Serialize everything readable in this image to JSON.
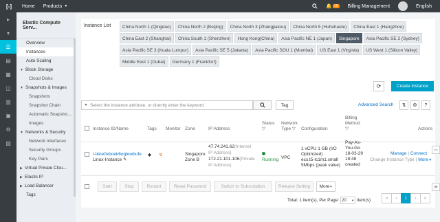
{
  "topbar": {
    "logo_glyph": "[-]",
    "home": "Home",
    "products": "Products",
    "notifications": "19",
    "billing": "Billing Management",
    "language": "English"
  },
  "sidebar": {
    "title": "Elastic Compute Serv...",
    "items": [
      {
        "label": "Overview",
        "kind": "item"
      },
      {
        "label": "Instances",
        "kind": "item",
        "active": true
      },
      {
        "label": "Auto Scaling",
        "kind": "item"
      },
      {
        "label": "Block Storage",
        "kind": "group"
      },
      {
        "label": "Cloud Disks",
        "kind": "sub"
      },
      {
        "label": "Snapshots & Images",
        "kind": "group"
      },
      {
        "label": "Snapshots",
        "kind": "sub"
      },
      {
        "label": "Snapshot Chain",
        "kind": "sub"
      },
      {
        "label": "Automatic Snapsho...",
        "kind": "sub"
      },
      {
        "label": "Images",
        "kind": "sub"
      },
      {
        "label": "Networks & Security",
        "kind": "group"
      },
      {
        "label": "Network Interfaces",
        "kind": "sub"
      },
      {
        "label": "Security Groups",
        "kind": "sub"
      },
      {
        "label": "Key Pairs",
        "kind": "sub"
      },
      {
        "label": "Virtual Private Clou...",
        "kind": "collapsed"
      },
      {
        "label": "Elastic IP",
        "kind": "collapsed"
      },
      {
        "label": "Load Balancer",
        "kind": "collapsed"
      },
      {
        "label": "Tags",
        "kind": "item"
      }
    ]
  },
  "instance_list": {
    "label": "Instance List",
    "regions": [
      "China North 1 (Qingdao)",
      "China North 2 (Beijing)",
      "China North 3 (Zhangjiakou)",
      "China North 5 (Huhehaote)",
      "China East 1 (Hangzhou)",
      "China East 2 (Shanghai)",
      "China South 1 (Shenzhen)",
      "Hong Kong(China)",
      "Asia Pacific NE 1 (Japan)",
      "Singapore",
      "Asia Pacific SE 2 (Sydney)",
      "Asia Pacific SE 3 (Kuala Lumpur)",
      "Asia Pacific SE 5 (Jakarta)",
      "Asia Pacific SOU 1 (Mumbai)",
      "US East 1 (Virginia)",
      "US West 1 (Silicon Valley)",
      "Middle East 1 (Dubai)",
      "Germany 1 (Frankfurt)"
    ],
    "selected_region": "Singapore",
    "create_button": "Create Instance",
    "refresh_glyph": "⟳"
  },
  "search": {
    "placeholder": "Select the instance attribute, or directly enter the keyword",
    "tag_button": "Tag",
    "advanced": "Advanced Search"
  },
  "table": {
    "headers": {
      "id": "Instance ID/Name",
      "tags": "Tags",
      "monitor": "Monitor",
      "zone": "Zone",
      "ip": "IP Address",
      "status": "Status",
      "network_line1": "Network",
      "network_line2": "Type",
      "config": "Configuration",
      "billing_line1": "Billing",
      "billing_line2": "Method",
      "actions": "Actions"
    },
    "row": {
      "id": "i-t4ne0xboek6ogtewbufe",
      "name": "Linux-Instance",
      "zone_line1": "Singapore",
      "zone_line2": "Zone B",
      "ip_public": "47.74.241.62",
      "ip_public_tag": "(Internet",
      "ip_public_tag2": "IP Address)",
      "ip_private": "172.21.101.106",
      "ip_private_tag": "(Private",
      "ip_private_tag2": "IP Address)",
      "status": "Running",
      "network": "VPC",
      "config_line1": "1 vCPU 1 GB (I/O",
      "config_line2": "Optimized)",
      "config_line3": "ecs.t5-lc1m1.small",
      "config_line4": "5Mbps (peak value)",
      "billing_line1": "Pay-As-",
      "billing_line2": "You-Go",
      "billing_line3": "18-03-29",
      "billing_line4": "18:48",
      "billing_line5": "created",
      "manage": "Manage",
      "connect": "Connect",
      "change_type": "Change Instance Type",
      "more": "More"
    }
  },
  "bulk_actions": [
    "Start",
    "Stop",
    "Restart",
    "Reset Password",
    "Switch to Subscription",
    "Release Setting",
    "More"
  ],
  "pagination": {
    "total_text": "Total: 1 item(s), Per Page:",
    "per_page": "20",
    "items_suffix": "item(s)",
    "current_page": "1",
    "first": "«",
    "prev": "‹",
    "next": "›",
    "last": "»"
  },
  "colors": {
    "topbar": "#373d41",
    "accent": "#00a2ca",
    "running": "#1e8e3e",
    "link": "#0070cc"
  }
}
